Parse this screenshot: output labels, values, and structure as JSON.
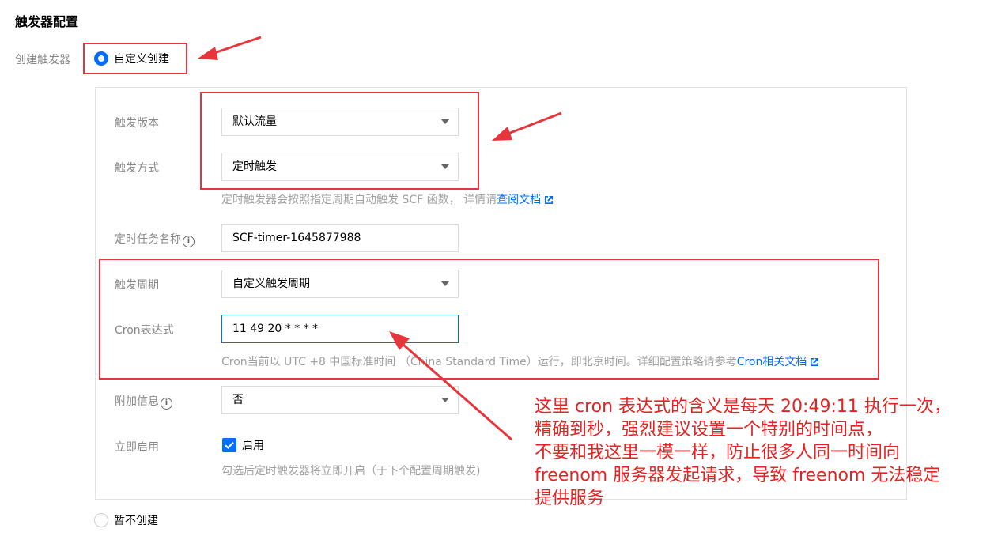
{
  "page": {
    "section_title": "触发器配置",
    "create_label": "创建触发器",
    "create_options": {
      "custom": "自定义创建",
      "none": "暂不创建"
    }
  },
  "form": {
    "version": {
      "label": "触发版本",
      "value": "默认流量"
    },
    "method": {
      "label": "触发方式",
      "value": "定时触发"
    },
    "method_hint": {
      "text": "定时触发器会按照指定周期自动触发 SCF 函数， 详情请",
      "link": "查阅文档"
    },
    "task_name": {
      "label": "定时任务名称",
      "value": "SCF-timer-1645877988"
    },
    "period": {
      "label": "触发周期",
      "value": "自定义触发周期"
    },
    "cron": {
      "label": "Cron表达式",
      "value": "11 49 20 * * * *"
    },
    "cron_hint": {
      "text": "Cron当前以 UTC +8 中国标准时间 （China Standard Time）运行，即北京时间。详细配置策略请参考",
      "link": "Cron相关文档"
    },
    "extra": {
      "label": "附加信息",
      "value": "否"
    },
    "enable": {
      "label": "立即启用",
      "checkbox_label": "启用",
      "checked": true,
      "hint": "勾选后定时触发器将立即开启（于下个配置周期触发)"
    }
  },
  "annotation": {
    "lines": [
      "这里 cron 表达式的含义是每天 20:49:11 执行一次，",
      "精确到秒，强烈建议设置一个特别的时间点，",
      "不要和我这里一模一样，防止很多人同一时间向",
      "freenom 服务器发起请求，导致 freenom 无法稳定",
      "提供服务"
    ]
  },
  "colors": {
    "accent": "#006eff",
    "annotation_red": "#e62222"
  }
}
